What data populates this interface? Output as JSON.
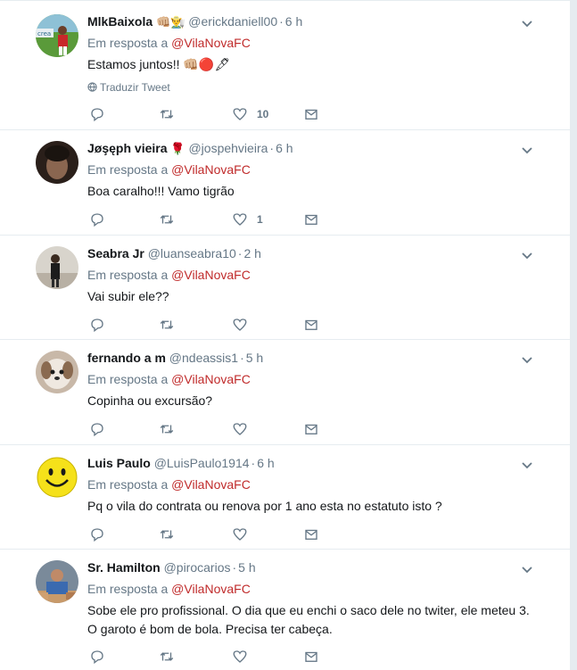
{
  "reply_prefix": "Em resposta a",
  "tweets": [
    {
      "name": "MlkBaixola",
      "name_emoji": "👊🏼👨‍🌾",
      "handle": "@erickdaniell00",
      "time": "6 h",
      "mention": "@VilaNovaFC",
      "text_lines": [
        "Estamos juntos!! 👊🏼🔴🖋"
      ],
      "translate": "Traduzir Tweet",
      "likes": "10"
    },
    {
      "name": "Jøşęph vieira",
      "name_emoji": "🌹",
      "handle": "@jospehvieira",
      "time": "6 h",
      "mention": "@VilaNovaFC",
      "text_lines": [
        "Boa caralho!!! Vamo tigrão"
      ],
      "likes": "1"
    },
    {
      "name": "Seabra Jr",
      "handle": "@luanseabra10",
      "time": "2 h",
      "mention": "@VilaNovaFC",
      "text_lines": [
        "Vai subir ele??"
      ],
      "likes": ""
    },
    {
      "name": "fernando a m",
      "handle": "@ndeassis1",
      "time": "5 h",
      "mention": "@VilaNovaFC",
      "text_lines": [
        "Copinha ou excursão?"
      ],
      "likes": ""
    },
    {
      "name": "Luis Paulo",
      "handle": "@LuisPaulo1914",
      "time": "6 h",
      "mention": "@VilaNovaFC",
      "text_lines": [
        "Pq o vila do contrata ou renova por 1 ano esta no estatuto isto ?"
      ],
      "likes": ""
    },
    {
      "name": "Sr. Hamilton",
      "handle": "@pirocarios",
      "time": "5 h",
      "mention": "@VilaNovaFC",
      "text_lines": [
        "Sobe ele pro profissional. O dia que eu enchi o saco dele no twiter, ele meteu 3.",
        "O garoto é bom de bola. Precisa ter cabeça."
      ],
      "likes": ""
    }
  ],
  "colors": {
    "mention": "#c02b2b",
    "secondary_text": "#657786",
    "icon": "#657786",
    "border": "#e6ecf0"
  }
}
